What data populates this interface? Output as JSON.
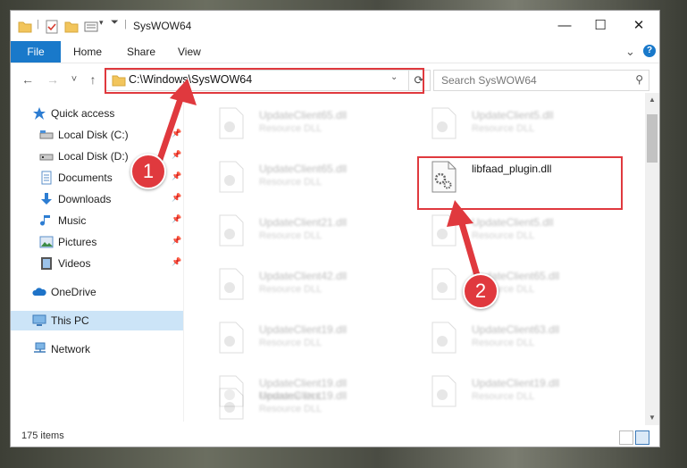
{
  "window": {
    "title": "SysWOW64",
    "controls": {
      "minimize": "—",
      "maximize": "☐",
      "close": "✕"
    }
  },
  "ribbon": {
    "tabs": [
      "File",
      "Home",
      "Share",
      "View"
    ],
    "collapse_icon": "⌄",
    "help_icon": "?"
  },
  "navigation": {
    "back": "←",
    "forward": "→",
    "recent": "˅",
    "up": "↑",
    "address": "C:\\Windows\\SysWOW64",
    "search_placeholder": "Search SysWOW64"
  },
  "sidebar": {
    "items": [
      {
        "label": "Quick access",
        "icon": "star-icon",
        "pinned": false
      },
      {
        "label": "Local Disk (C:)",
        "icon": "drive-icon",
        "pinned": true
      },
      {
        "label": "Local Disk (D:)",
        "icon": "drive-icon",
        "pinned": true
      },
      {
        "label": "Documents",
        "icon": "documents-icon",
        "pinned": true
      },
      {
        "label": "Downloads",
        "icon": "download-icon",
        "pinned": true
      },
      {
        "label": "Music",
        "icon": "music-icon",
        "pinned": true
      },
      {
        "label": "Pictures",
        "icon": "pictures-icon",
        "pinned": true
      },
      {
        "label": "Videos",
        "icon": "videos-icon",
        "pinned": true
      },
      {
        "label": "OneDrive",
        "icon": "cloud-icon",
        "pinned": false
      },
      {
        "label": "This PC",
        "icon": "computer-icon",
        "pinned": false,
        "selected": true
      },
      {
        "label": "Network",
        "icon": "network-icon",
        "pinned": false
      }
    ]
  },
  "files": {
    "left": [
      {
        "name": "UpdateClient65.dll",
        "type": "Resource DLL"
      },
      {
        "name": "UpdateClient65.dll",
        "type": "Resource DLL"
      },
      {
        "name": "UpdateClient21.dll",
        "type": "Resource DLL"
      },
      {
        "name": "UpdateClient42.dll",
        "type": "Resource DLL"
      },
      {
        "name": "UpdateClient19.dll",
        "type": "Resource DLL"
      },
      {
        "name": "UpdateClient19.dll",
        "type": "Resource DLL"
      },
      {
        "name": "UpdateClient19.dll",
        "type": "Resource DLL"
      }
    ],
    "right": [
      {
        "name": "UpdateClient5.dll",
        "type": "Resource DLL"
      },
      {
        "name": "libfaad_plugin.dll",
        "type": ""
      },
      {
        "name": "UpdateClient5.dll",
        "type": "Resource DLL"
      },
      {
        "name": "UpdateClient65.dll",
        "type": "Resource DLL"
      },
      {
        "name": "UpdateClient63.dll",
        "type": "Resource DLL"
      },
      {
        "name": "UpdateClient19.dll",
        "type": "Resource DLL"
      }
    ]
  },
  "status": {
    "item_count": "175 items"
  },
  "annotations": {
    "step1": "1",
    "step2": "2",
    "color": "#e0393e"
  },
  "colors": {
    "accent": "#1979ca",
    "selected": "#cce4f7"
  }
}
